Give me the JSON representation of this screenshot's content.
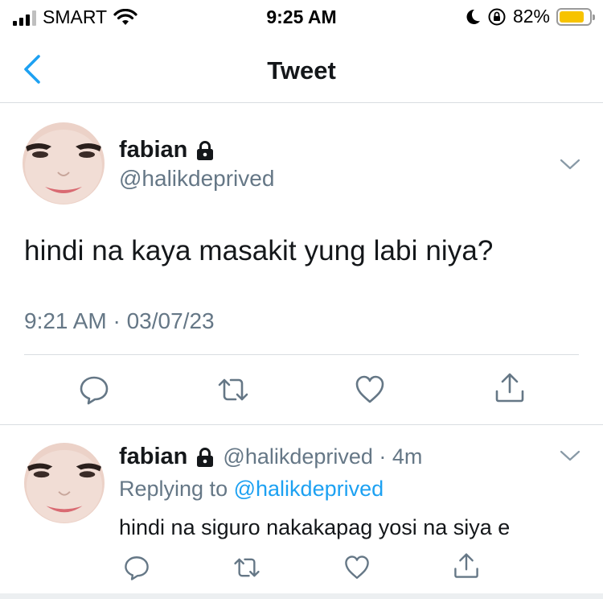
{
  "status_bar": {
    "carrier": "SMART",
    "time": "9:25 AM",
    "battery_percent": "82%",
    "battery_level": 0.82,
    "battery_color": "#f7c300"
  },
  "nav": {
    "title": "Tweet",
    "back_icon": "chevron-left-icon",
    "accent": "#1da1f2"
  },
  "main_tweet": {
    "display_name": "fabian",
    "handle": "@halikdeprived",
    "text": "hindi na kaya masakit yung labi niya?",
    "timestamp": "9:21 AM · 03/07/23",
    "actions": [
      "reply-icon",
      "retweet-icon",
      "like-icon",
      "share-icon"
    ]
  },
  "reply_tweet": {
    "display_name": "fabian",
    "handle_time": "@halikdeprived · 4m",
    "replying_label": "Replying to",
    "replying_to": "@halikdeprived",
    "text": "hindi na siguro nakakapag yosi na siya e",
    "actions": [
      "reply-icon",
      "retweet-icon",
      "like-icon",
      "share-icon"
    ]
  }
}
